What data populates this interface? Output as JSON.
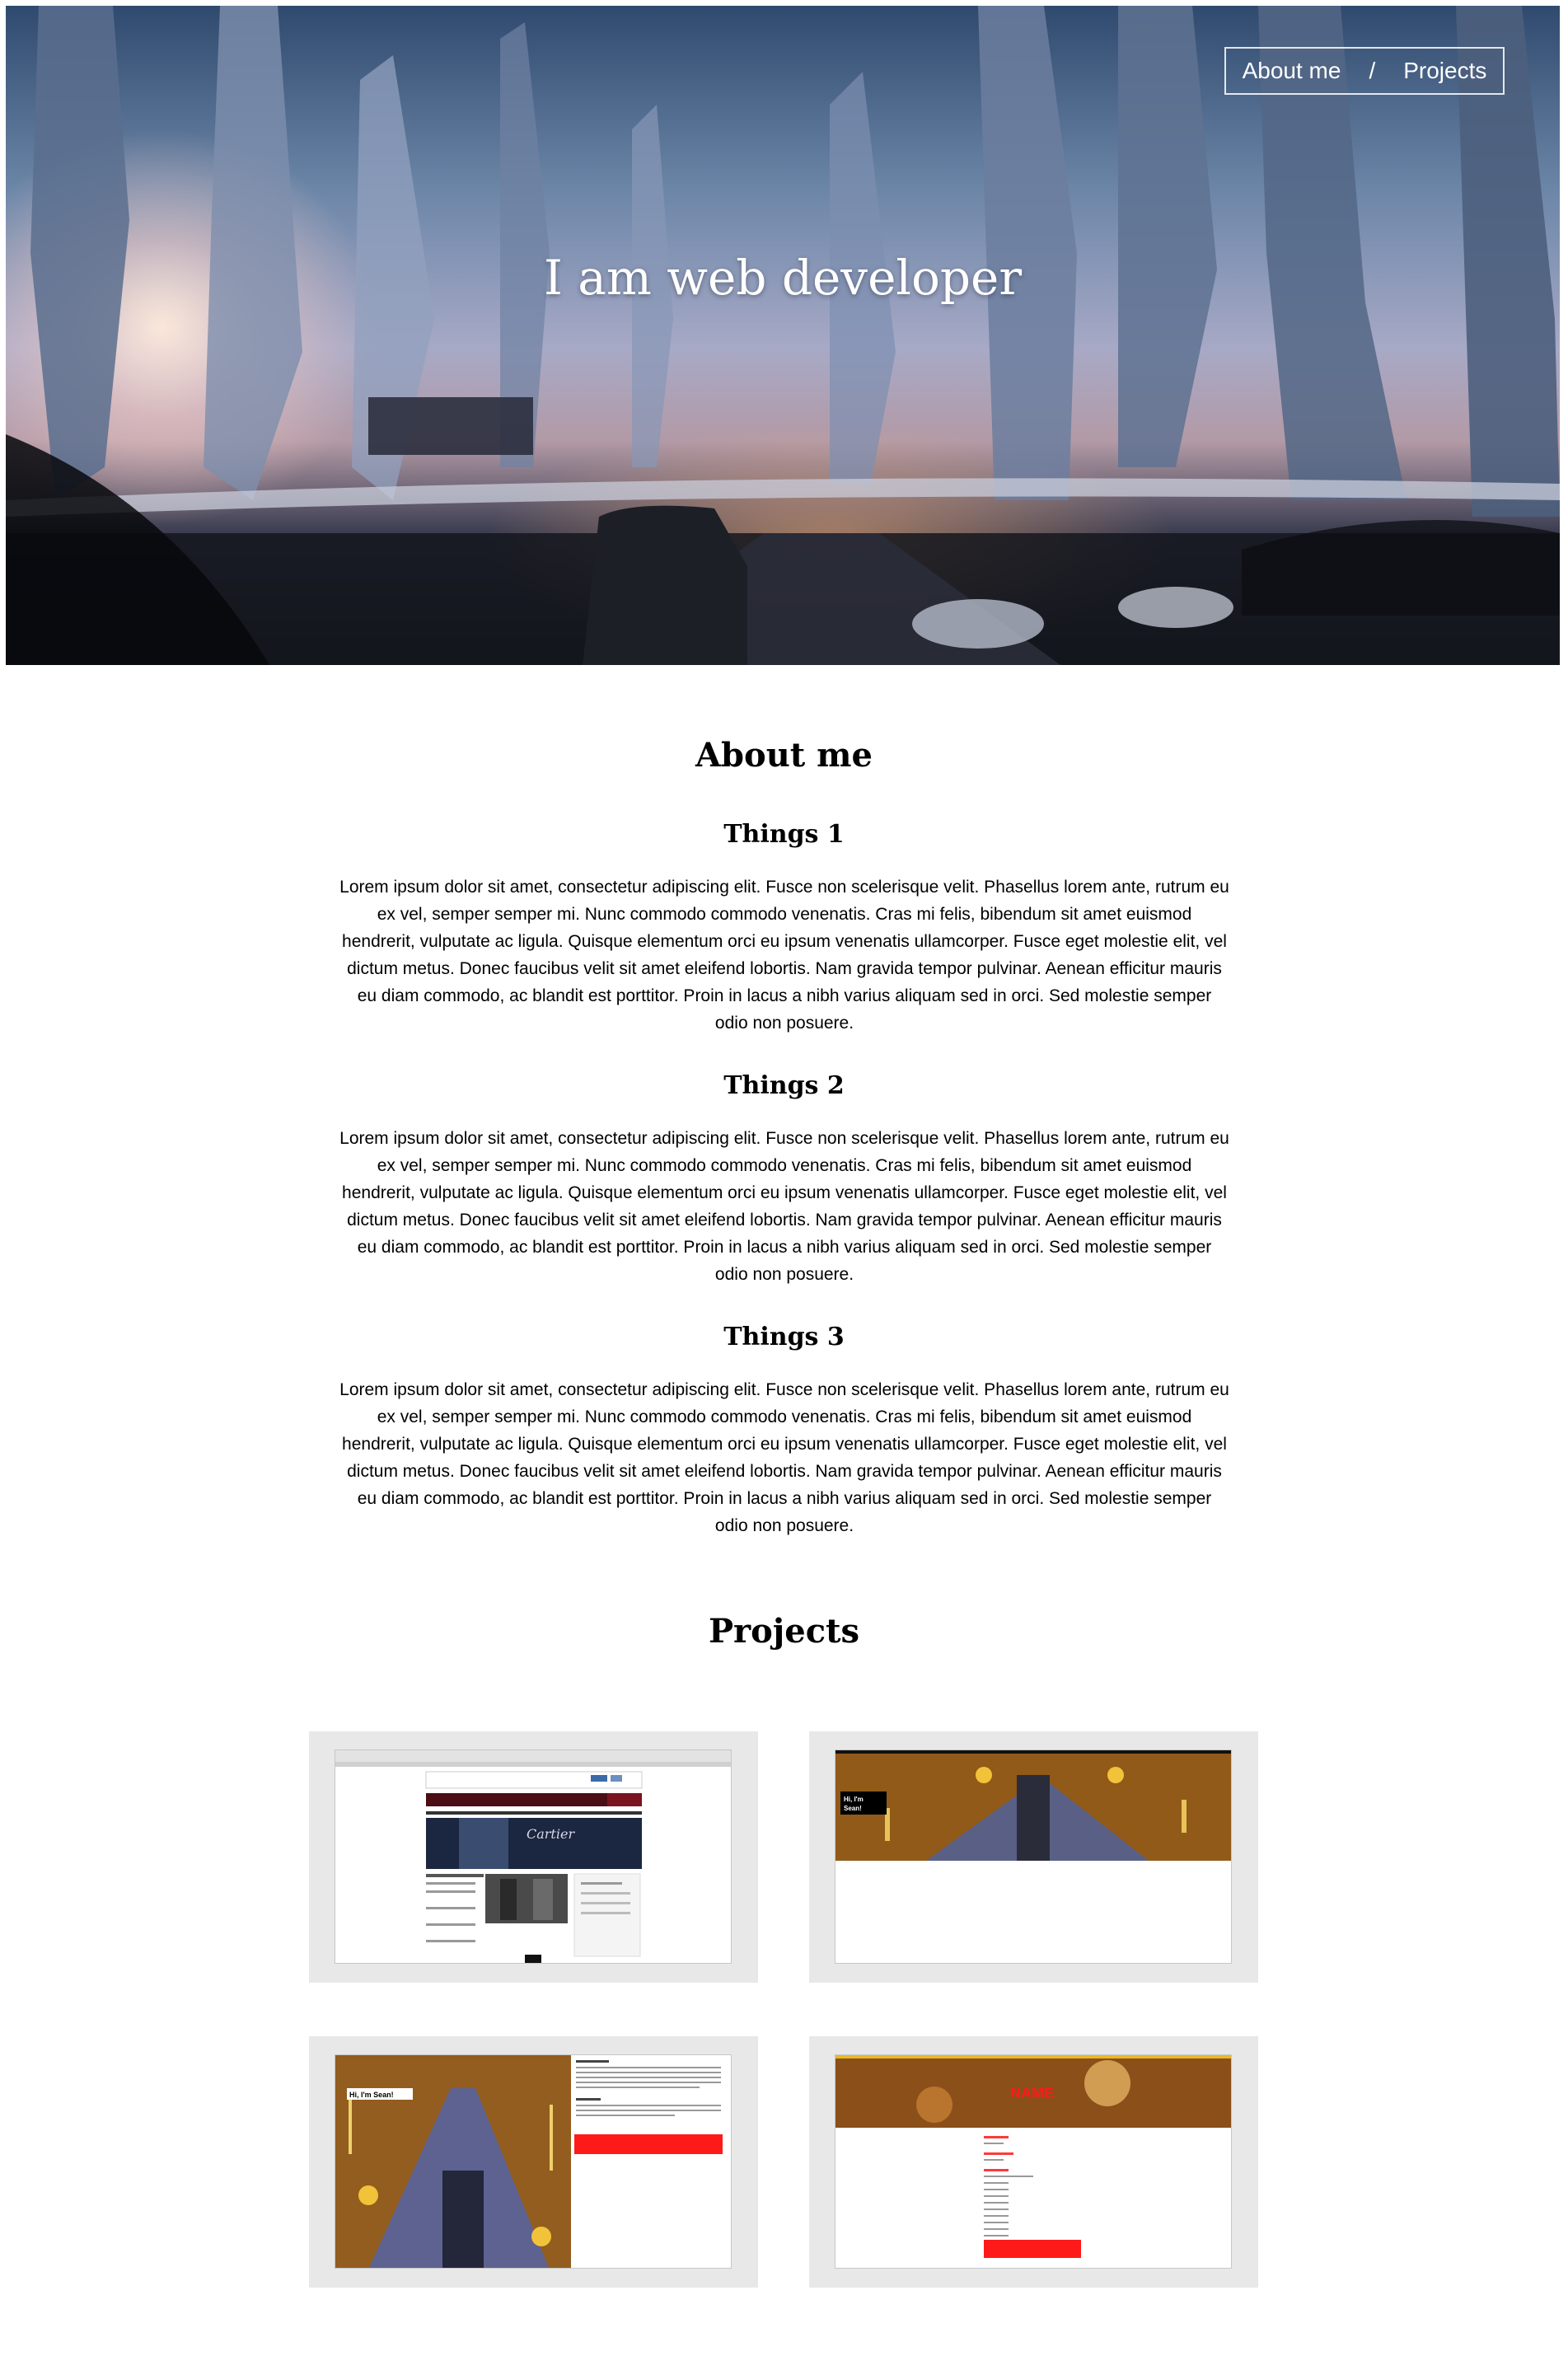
{
  "nav": {
    "about_label": "About me",
    "separator": "/",
    "projects_label": "Projects"
  },
  "hero": {
    "title": "I am web developer"
  },
  "about": {
    "heading": "About me",
    "items": [
      {
        "title": "Things 1",
        "text": "Lorem ipsum dolor sit amet, consectetur adipiscing elit. Fusce non scelerisque velit. Phasellus lorem ante, rutrum eu ex vel, semper semper mi. Nunc commodo commodo venenatis. Cras mi felis, bibendum sit amet euismod hendrerit, vulputate ac ligula. Quisque elementum orci eu ipsum venenatis ullamcorper. Fusce eget molestie elit, vel dictum metus. Donec faucibus velit sit amet eleifend lobortis. Nam gravida tempor pulvinar. Aenean efficitur mauris eu diam commodo, ac blandit est porttitor. Proin in lacus a nibh varius aliquam sed in orci. Sed molestie semper odio non posuere."
      },
      {
        "title": "Things 2",
        "text": "Lorem ipsum dolor sit amet, consectetur adipiscing elit. Fusce non scelerisque velit. Phasellus lorem ante, rutrum eu ex vel, semper semper mi. Nunc commodo commodo venenatis. Cras mi felis, bibendum sit amet euismod hendrerit, vulputate ac ligula. Quisque elementum orci eu ipsum venenatis ullamcorper. Fusce eget molestie elit, vel dictum metus. Donec faucibus velit sit amet eleifend lobortis. Nam gravida tempor pulvinar. Aenean efficitur mauris eu diam commodo, ac blandit est porttitor. Proin in lacus a nibh varius aliquam sed in orci. Sed molestie semper odio non posuere."
      },
      {
        "title": "Things 3",
        "text": "Lorem ipsum dolor sit amet, consectetur adipiscing elit. Fusce non scelerisque velit. Phasellus lorem ante, rutrum eu ex vel, semper semper mi. Nunc commodo commodo venenatis. Cras mi felis, bibendum sit amet euismod hendrerit, vulputate ac ligula. Quisque elementum orci eu ipsum venenatis ullamcorper. Fusce eget molestie elit, vel dictum metus. Donec faucibus velit sit amet eleifend lobortis. Nam gravida tempor pulvinar. Aenean efficitur mauris eu diam commodo, ac blandit est porttitor. Proin in lacus a nibh varius aliquam sed in orci. Sed molestie semper odio non posuere."
      }
    ]
  },
  "projects": {
    "heading": "Projects",
    "thumbs": {
      "p1_brand": "Cartier",
      "p2_greeting_line1": "Hi, I'm",
      "p2_greeting_line2": "Sean!",
      "p3_greeting": "Hi, I'm Sean!",
      "p4_name": "NAME"
    }
  },
  "colors": {
    "accent_red": "#ff1a1a",
    "card_bg": "#e8e8e8"
  }
}
